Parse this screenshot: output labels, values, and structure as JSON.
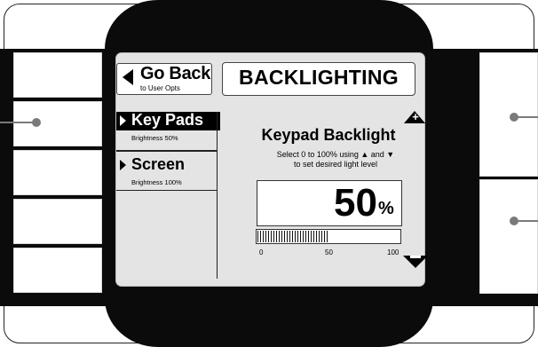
{
  "header": {
    "back_button": {
      "label": "Go Back",
      "sublabel": "to User Opts"
    },
    "title": "BACKLIGHTING"
  },
  "menu": {
    "items": [
      {
        "label": "Key Pads",
        "sublabel": "Brightness 50%",
        "selected": true
      },
      {
        "label": "Screen",
        "sublabel": "Brightness 100%",
        "selected": false
      }
    ]
  },
  "panel": {
    "heading": "Keypad Backlight",
    "instruction_line1": "Select 0 to 100% using ▲ and ▼",
    "instruction_line2": "to set desired light level",
    "value": "50",
    "unit": "%",
    "level_fraction": 0.5,
    "slider_ticks": [
      "0",
      "50",
      "100"
    ],
    "up_icon": "plus-up-arrow-icon",
    "down_icon": "minus-down-arrow-icon"
  },
  "colors": {
    "bezel": "#0b0b0b",
    "screen": "#e4e4e4",
    "selected_item": "#000000"
  }
}
